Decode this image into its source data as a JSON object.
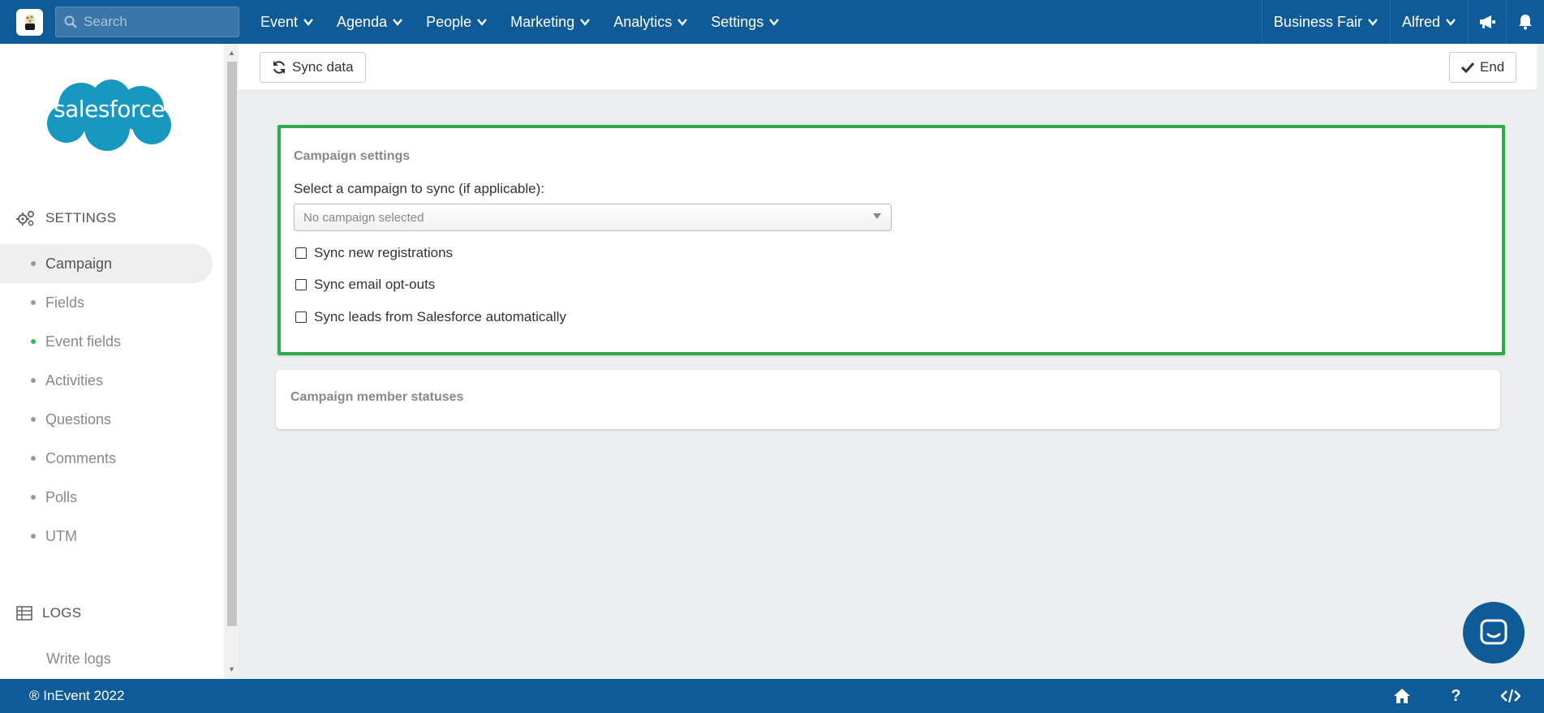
{
  "topnav": {
    "search_placeholder": "Search",
    "menu": [
      "Event",
      "Agenda",
      "People",
      "Marketing",
      "Analytics",
      "Settings"
    ],
    "event_selector": "Business Fair",
    "user": "Alfred"
  },
  "sidebar": {
    "logo_text": "salesforce",
    "settings_heading": "SETTINGS",
    "items": [
      {
        "label": "Campaign"
      },
      {
        "label": "Fields"
      },
      {
        "label": "Event fields"
      },
      {
        "label": "Activities"
      },
      {
        "label": "Questions"
      },
      {
        "label": "Comments"
      },
      {
        "label": "Polls"
      },
      {
        "label": "UTM"
      }
    ],
    "logs_heading": "LOGS",
    "logs_items": [
      {
        "label": "Write logs"
      }
    ]
  },
  "toolbar": {
    "sync_label": "Sync data",
    "end_label": "End"
  },
  "campaign_settings": {
    "title": "Campaign settings",
    "select_label": "Select a campaign to sync (if applicable):",
    "select_value": "No campaign selected",
    "options": [
      {
        "label": "Sync new registrations"
      },
      {
        "label": "Sync email opt-outs"
      },
      {
        "label": "Sync leads from Salesforce automatically"
      }
    ]
  },
  "member_statuses": {
    "title": "Campaign member statuses"
  },
  "footer": {
    "copyright": "® InEvent 2022",
    "help_glyph": "?"
  },
  "colors": {
    "brand": "#0e5b98",
    "highlight": "#2eac4a",
    "salesforce": "#1798c1"
  }
}
